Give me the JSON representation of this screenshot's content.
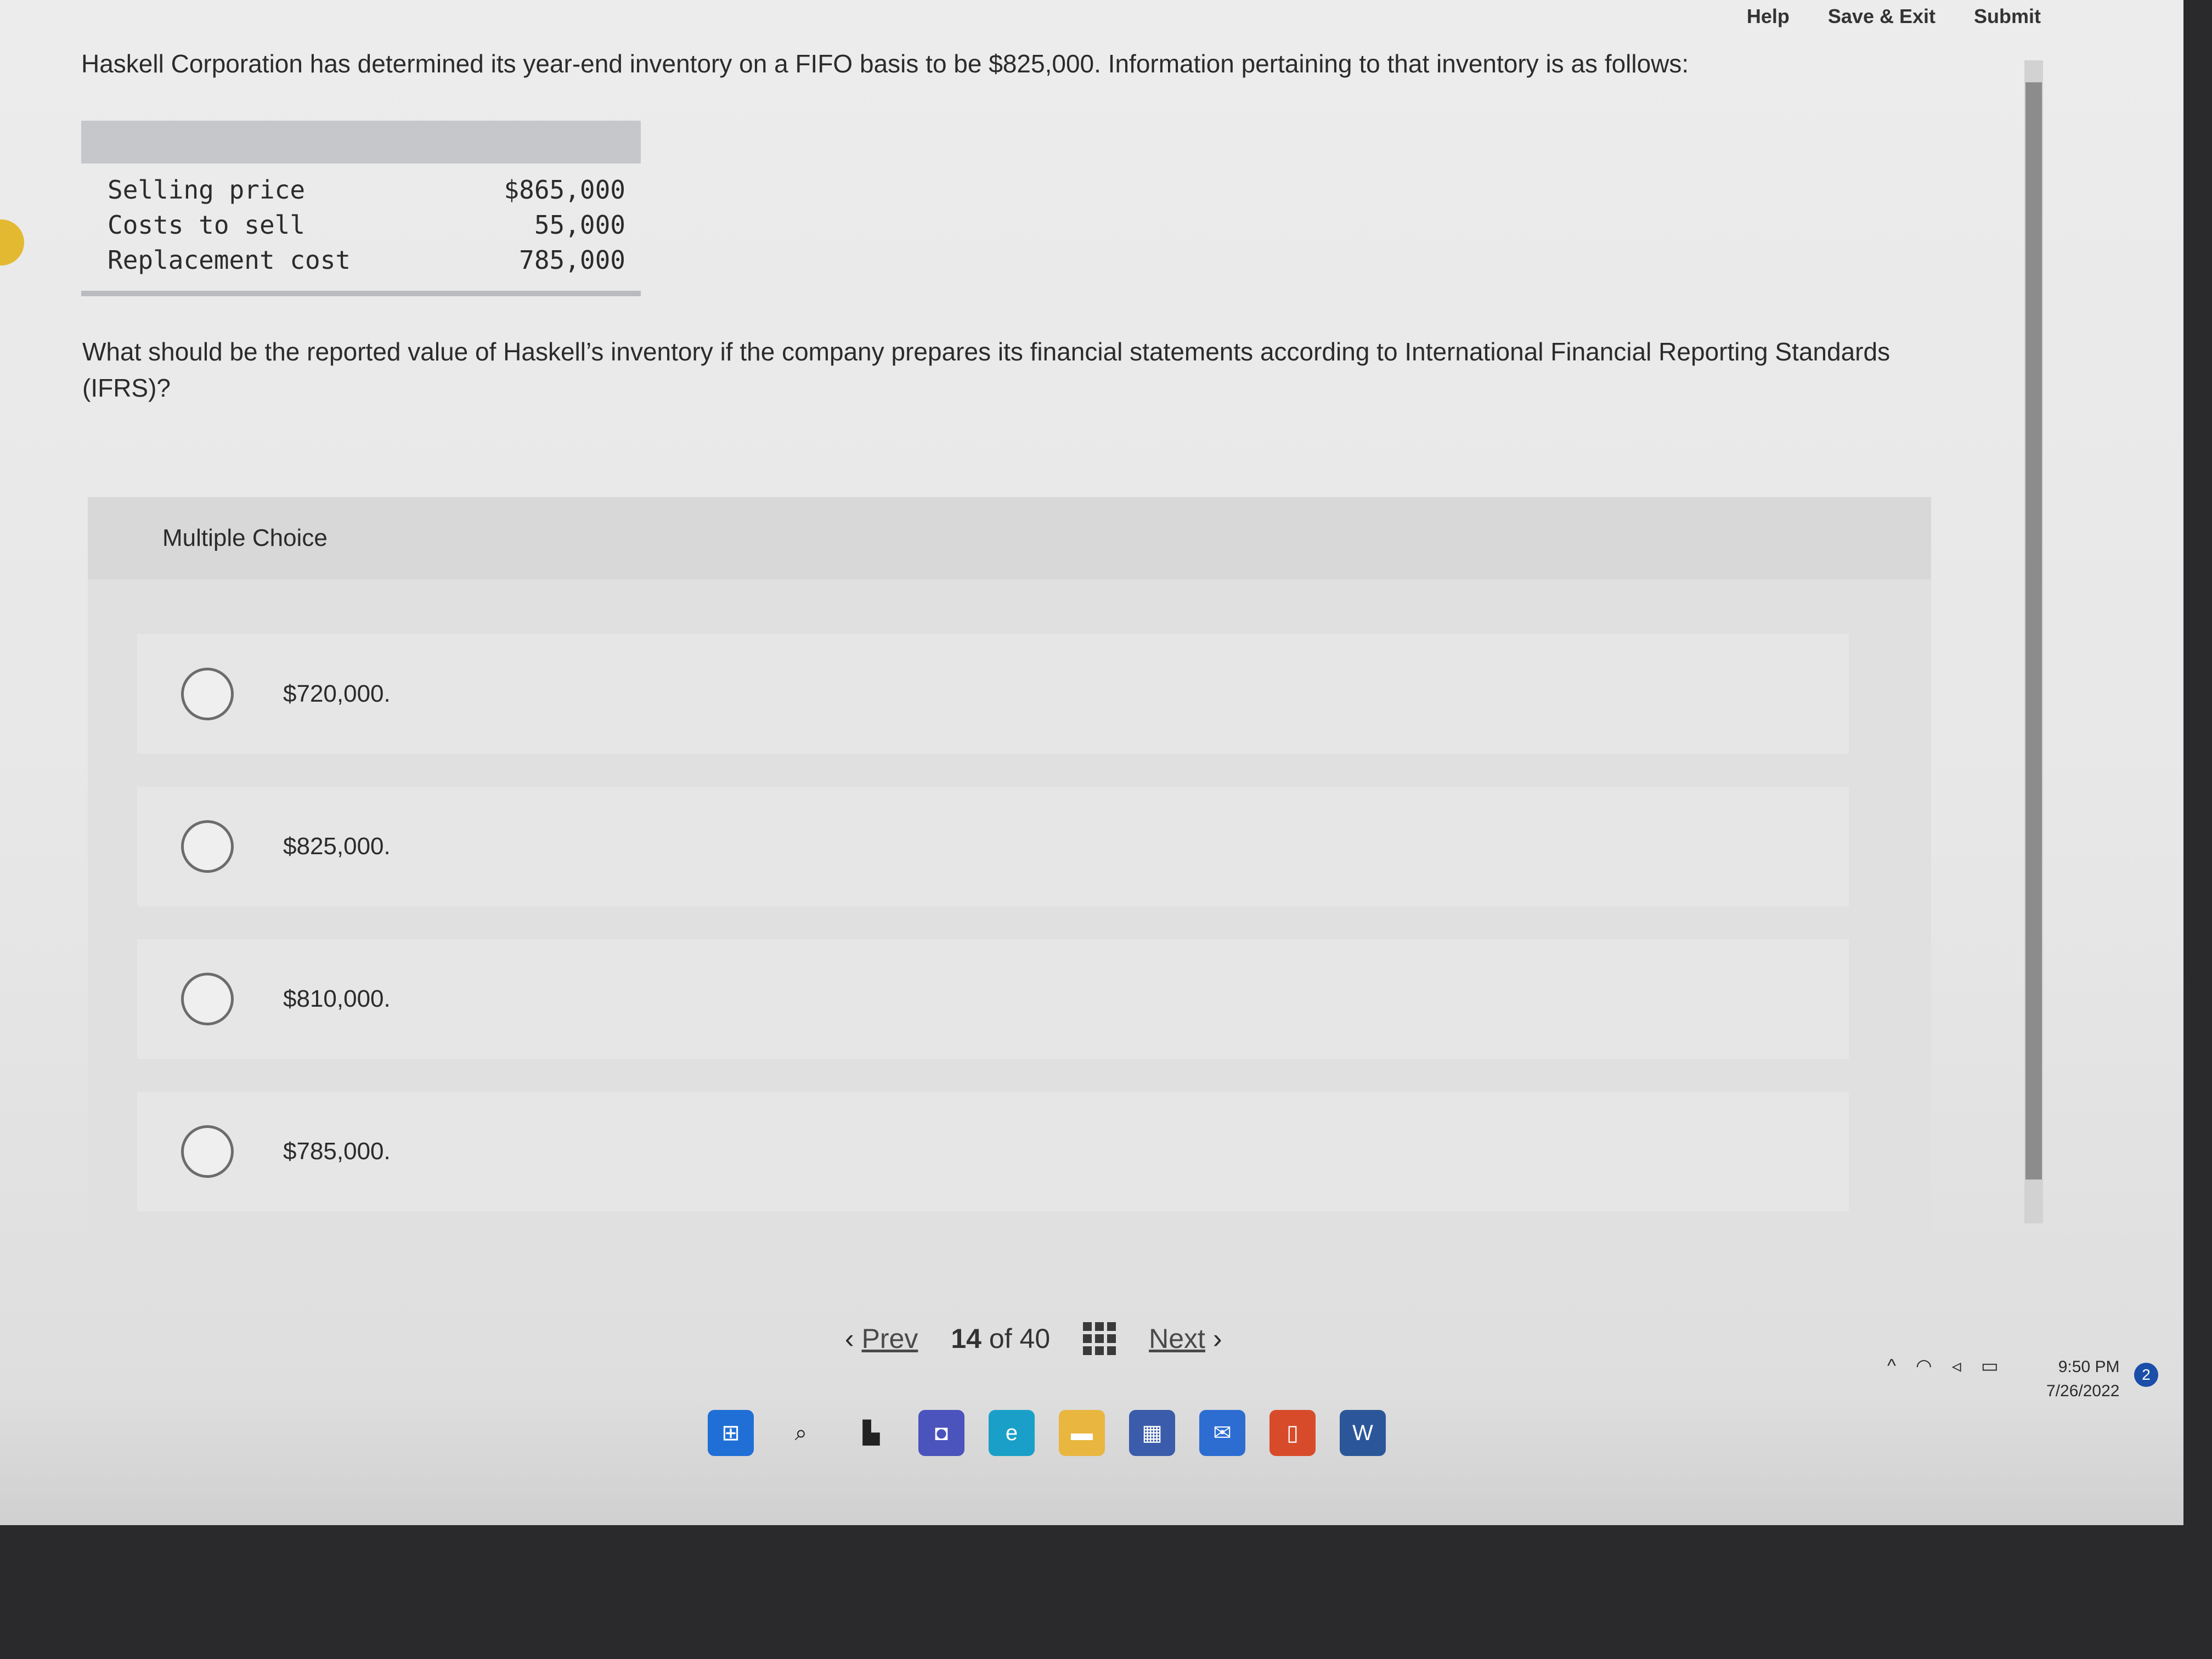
{
  "toolbar": {
    "help_label": "Help",
    "save_exit_label": "Save & Exit",
    "submit_label": "Submit"
  },
  "question": {
    "intro": "Haskell Corporation has determined its year-end inventory on a FIFO basis to be $825,000. Information pertaining to that inventory is as follows:",
    "table": [
      {
        "label": "Selling price",
        "value": "$865,000"
      },
      {
        "label": "Costs to sell",
        "value": "55,000"
      },
      {
        "label": "Replacement cost",
        "value": "785,000"
      }
    ],
    "prompt": "What should be the reported value of Haskell’s inventory if the company prepares its financial statements according to International Financial Reporting Standards (IFRS)?"
  },
  "multiple_choice": {
    "heading": "Multiple Choice",
    "options": [
      "$720,000.",
      "$825,000.",
      "$810,000.",
      "$785,000."
    ]
  },
  "navigation": {
    "prev_label": "Prev",
    "current": "14",
    "of_label": "of",
    "total": "40",
    "next_label": "Next"
  },
  "system_tray": {
    "time": "9:50 PM",
    "date": "7/26/2022",
    "notification_count": "2"
  },
  "taskbar_icons": [
    "windows-start-icon",
    "search-icon",
    "task-view-icon",
    "teams-chat-icon",
    "edge-browser-icon",
    "file-explorer-icon",
    "store-icon",
    "mail-icon",
    "office-icon",
    "word-icon"
  ]
}
